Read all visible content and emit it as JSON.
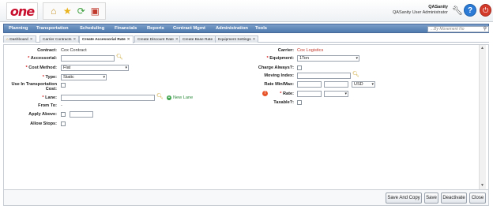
{
  "header": {
    "logo_text": "one",
    "user_name": "QASanity",
    "user_role": "QASanity User Administrator",
    "icons": [
      "home-icon",
      "favorites-star-icon",
      "refresh-icon",
      "presentation-icon",
      "wrench-icon",
      "help-icon",
      "power-icon"
    ]
  },
  "nav": {
    "items": [
      "Planning",
      "Transportation",
      "Scheduling",
      "Financials",
      "Reports",
      "Contract Mgmt",
      "Administration",
      "Tools"
    ],
    "search_placeholder": "...By Movement No"
  },
  "tabs": [
    {
      "label": "Dashboard",
      "active": false
    },
    {
      "label": "Carrier Contracts",
      "active": false
    },
    {
      "label": "Create Accessorial Rate",
      "active": true
    },
    {
      "label": "Create Discount Rate",
      "active": false
    },
    {
      "label": "Create Base Rate",
      "active": false
    },
    {
      "label": "Equipment Settings",
      "active": false
    }
  ],
  "form": {
    "left": {
      "contract_label": "Contract:",
      "contract_value": "Cox Contract",
      "accessorial_label": "Accessorial:",
      "accessorial_value": "",
      "cost_method_label": "Cost Method:",
      "cost_method_value": "Flat",
      "type_label": "Type:",
      "type_value": "Static",
      "use_in_transport_label_1": "Use In Transportation",
      "use_in_transport_label_2": "Cost:",
      "lane_label": "Lane:",
      "lane_value": "",
      "new_lane_link": "New Lane",
      "from_to_label": "From To:",
      "from_to_value": "-",
      "apply_above_label": "Apply Above:",
      "apply_above_value": "",
      "allow_stops_label": "Allow Stops:"
    },
    "right": {
      "carrier_label": "Carrier:",
      "carrier_value": "Cox Logistics",
      "equipment_label": "Equipment:",
      "equipment_value": "1Ton",
      "charge_always_label": "Charge Always?:",
      "moving_index_label": "Moving Index:",
      "moving_index_value": "",
      "rate_minmax_label": "Rate Min/Max:",
      "rate_min_value": "",
      "rate_max_value": "",
      "currency_value": "USD",
      "rate_label": "Rate:",
      "rate_value": "",
      "rate_unit_value": "",
      "taxable_label": "Taxable?:"
    }
  },
  "footer": {
    "save_and_copy": "Save And Copy",
    "save": "Save",
    "deactivate": "Deactivate",
    "close": "Close"
  },
  "colors": {
    "nav_blue": "#4f7aae",
    "logo_red": "#c8102e",
    "required_red": "#d21b1b",
    "link_green": "#2e8b3d"
  }
}
